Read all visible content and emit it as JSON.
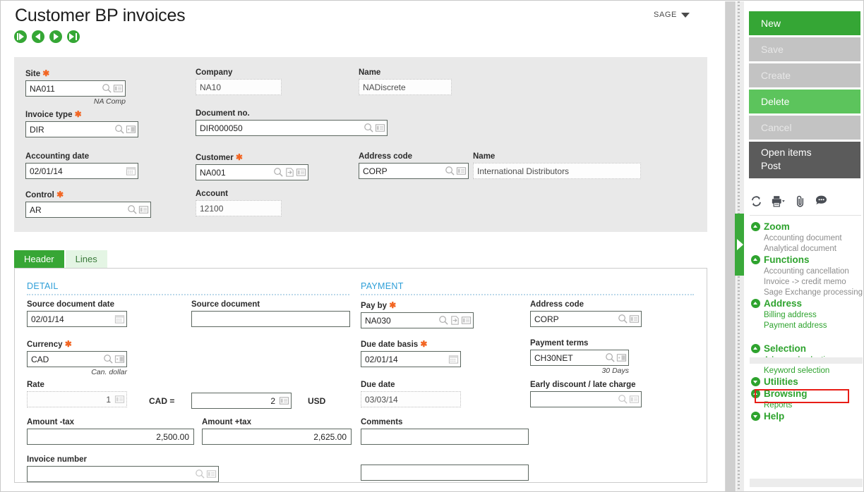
{
  "window": {
    "title": "Customer BP invoices",
    "brand": "SAGE"
  },
  "record_nav": [
    {
      "name": "first",
      "label": "First record"
    },
    {
      "name": "previous",
      "label": "Previous record"
    },
    {
      "name": "next",
      "label": "Next record"
    },
    {
      "name": "last",
      "label": "Last record"
    }
  ],
  "header_panel": {
    "site": {
      "label": "Site",
      "required": true,
      "value": "NA011",
      "sub": "NA Comp"
    },
    "company": {
      "label": "Company",
      "required": false,
      "value": "NA10"
    },
    "name": {
      "label": "Name",
      "required": false,
      "value": "NADiscrete"
    },
    "invoice_type": {
      "label": "Invoice type",
      "required": true,
      "value": "DIR"
    },
    "document_no": {
      "label": "Document no.",
      "required": false,
      "value": "DIR000050"
    },
    "accounting_date": {
      "label": "Accounting date",
      "required": false,
      "value": "02/01/14"
    },
    "customer": {
      "label": "Customer",
      "required": true,
      "value": "NA001"
    },
    "address_code": {
      "label": "Address code",
      "required": false,
      "value": "CORP"
    },
    "address_name": {
      "label": "Name",
      "required": false,
      "value": "International Distributors"
    },
    "control": {
      "label": "Control",
      "required": true,
      "value": "AR"
    },
    "account": {
      "label": "Account",
      "required": false,
      "value": "12100"
    }
  },
  "tabs": [
    {
      "label": "Header",
      "active": true
    },
    {
      "label": "Lines",
      "active": false
    }
  ],
  "detail_section": {
    "title": "DETAIL",
    "source_document_date": {
      "label": "Source document date",
      "required": false,
      "value": "02/01/14"
    },
    "source_document": {
      "label": "Source document",
      "required": false,
      "value": ""
    },
    "currency": {
      "label": "Currency",
      "required": true,
      "value": "CAD",
      "sub": "Can. dollar"
    },
    "rate": {
      "label": "Rate",
      "required": false,
      "value": "1"
    },
    "rate_equals": "CAD =",
    "rate_target": {
      "value": "2"
    },
    "rate_target_currency": "USD",
    "amount_ex_tax": {
      "label": "Amount -tax",
      "required": false,
      "value": "2,500.00"
    },
    "amount_inc_tax": {
      "label": "Amount +tax",
      "required": false,
      "value": "2,625.00"
    },
    "invoice_number": {
      "label": "Invoice number",
      "required": false,
      "value": ""
    }
  },
  "payment_section": {
    "title": "PAYMENT",
    "pay_by": {
      "label": "Pay by",
      "required": true,
      "value": "NA030"
    },
    "address_code": {
      "label": "Address code",
      "required": false,
      "value": "CORP"
    },
    "due_date_basis": {
      "label": "Due date basis",
      "required": true,
      "value": "02/01/14"
    },
    "payment_terms": {
      "label": "Payment terms",
      "required": false,
      "value": "CH30NET",
      "sub": "30 Days"
    },
    "due_date": {
      "label": "Due date",
      "required": false,
      "value": "03/03/14"
    },
    "early_discount": {
      "label": "Early discount / late charge",
      "required": false,
      "value": ""
    },
    "comments": {
      "label": "Comments",
      "required": false,
      "value": ""
    },
    "extra_field": {
      "value": ""
    }
  },
  "sidebar": {
    "buttons": [
      {
        "label": "New",
        "state": "green"
      },
      {
        "label": "Save",
        "state": "grey"
      },
      {
        "label": "Create",
        "state": "grey"
      },
      {
        "label": "Delete",
        "state": "green2"
      },
      {
        "label": "Cancel",
        "state": "grey"
      }
    ],
    "dark_button": {
      "line1": "Open items",
      "line2": "Post"
    },
    "tools": [
      {
        "icon": "refresh-icon"
      },
      {
        "icon": "print-icon"
      },
      {
        "icon": "attachment-icon"
      },
      {
        "icon": "comment-icon"
      }
    ],
    "menu": [
      {
        "header": "Zoom",
        "expanded": true,
        "items": [
          {
            "label": "Accounting document",
            "enabled": false
          },
          {
            "label": "Analytical document",
            "enabled": false
          }
        ]
      },
      {
        "header": "Functions",
        "expanded": true,
        "items": [
          {
            "label": "Accounting cancellation",
            "enabled": false
          },
          {
            "label": "Invoice -> credit memo",
            "enabled": false
          },
          {
            "label": "Sage Exchange processing",
            "enabled": false
          }
        ]
      },
      {
        "header": "Address",
        "expanded": true,
        "items": [
          {
            "label": "Billing address",
            "enabled": true
          },
          {
            "label": "Payment address",
            "enabled": true
          }
        ]
      },
      {
        "header": "Selection",
        "expanded": true,
        "items": [
          {
            "label": "Advanced selection",
            "enabled": true,
            "highlighted": true
          },
          {
            "label": "Keyword selection",
            "enabled": true
          }
        ]
      },
      {
        "header": "Utilities",
        "expanded": false,
        "items": []
      },
      {
        "header": "Browsing",
        "expanded": true,
        "items": [
          {
            "label": "Reports",
            "enabled": true
          }
        ]
      },
      {
        "header": "Help",
        "expanded": false,
        "items": []
      }
    ]
  },
  "colors": {
    "accent_green": "#35a635",
    "panel_grey": "#e9e9e9",
    "required_star": "#f26522",
    "section_blue": "#2e9fd8",
    "highlight_red": "#e81d16"
  }
}
